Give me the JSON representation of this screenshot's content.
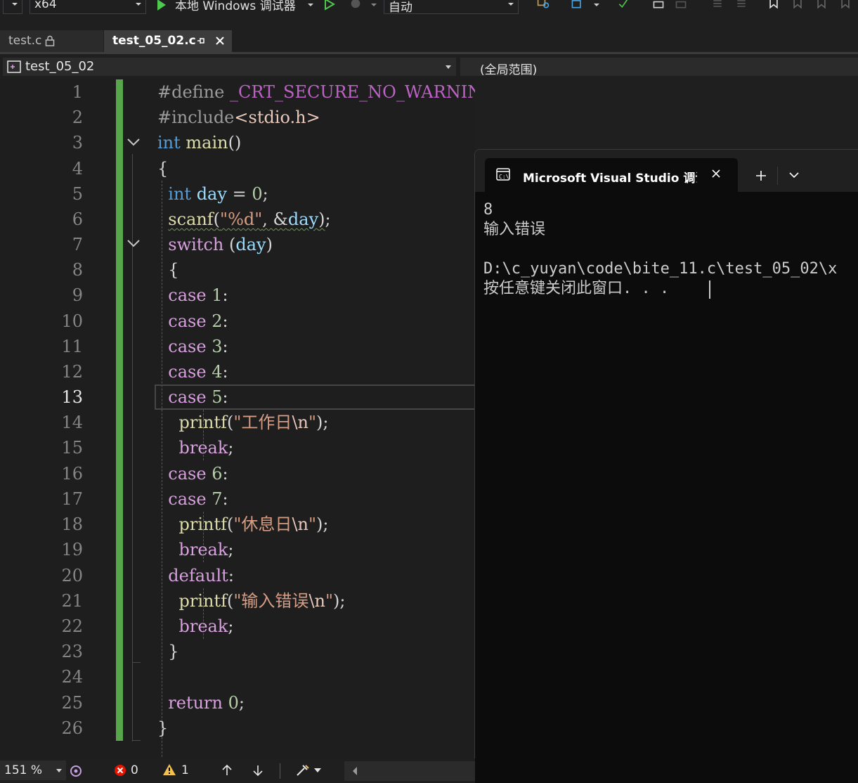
{
  "toolbar": {
    "platform": "x64",
    "run_label": "本地 Windows 调试器",
    "config": "自动"
  },
  "tabs": [
    {
      "label": "test.c"
    },
    {
      "label": "test_05_02.c"
    }
  ],
  "navbar": {
    "project": "test_05_02",
    "scope": "(全局范围)"
  },
  "editor": {
    "current_line": 13,
    "line_numbers": [
      "1",
      "2",
      "3",
      "4",
      "5",
      "6",
      "7",
      "8",
      "9",
      "10",
      "11",
      "12",
      "13",
      "14",
      "15",
      "16",
      "17",
      "18",
      "19",
      "20",
      "21",
      "22",
      "23",
      "24",
      "25",
      "26"
    ]
  },
  "console": {
    "title": "Microsoft Visual Studio 调试控制台",
    "output": "8\n输入错误\n\nD:\\c_yuyan\\code\\bite_11.c\\test_05_02\\x\n按任意键关闭此窗口. . ."
  },
  "statusbar": {
    "zoom": "151 %",
    "errors": "0",
    "warnings": "1"
  },
  "colors": {
    "keyword": "#569cd6",
    "control": "#d8a0df",
    "function": "#dcdcaa",
    "variable": "#9cdcfe",
    "string": "#d69d85",
    "number": "#b5cea8",
    "change_bar": "#57a64a"
  }
}
